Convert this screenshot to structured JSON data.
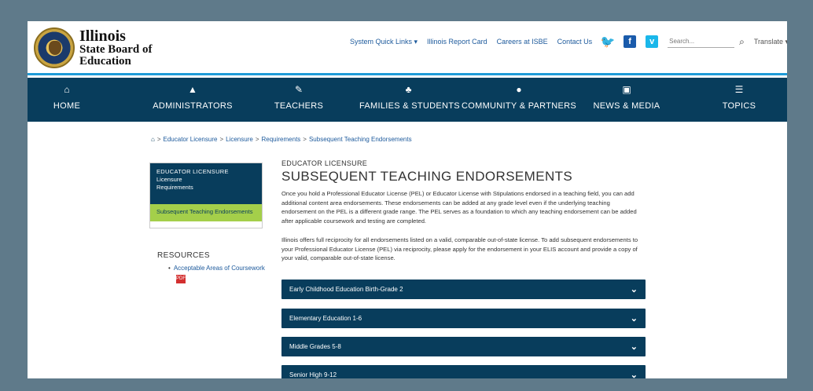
{
  "header": {
    "logo_line1": "Illinois",
    "logo_line2": "State Board of",
    "logo_line3": "Education",
    "utility_links": [
      "System Quick Links ▾",
      "Illinois Report Card",
      "Careers at ISBE",
      "Contact Us"
    ],
    "search_placeholder": "Search...",
    "language": "Translate ▾"
  },
  "nav": [
    {
      "label": "HOME",
      "icon": "home-icon",
      "glyph": "⌂"
    },
    {
      "label": "ADMINISTRATORS",
      "icon": "administrator-icon",
      "glyph": "▲"
    },
    {
      "label": "TEACHERS",
      "icon": "teacher-icon",
      "glyph": "✎"
    },
    {
      "label": "FAMILIES & STUDENTS",
      "icon": "family-icon",
      "glyph": "♣"
    },
    {
      "label": "COMMUNITY & PARTNERS",
      "icon": "community-icon",
      "glyph": "●"
    },
    {
      "label": "NEWS & MEDIA",
      "icon": "news-icon",
      "glyph": "▣"
    },
    {
      "label": "TOPICS",
      "icon": "topics-icon",
      "glyph": "☰"
    }
  ],
  "breadcrumb": [
    "Educator Licensure",
    "Licensure",
    "Requirements",
    "Subsequent Teaching Endorsements"
  ],
  "sidebar": {
    "heading": "EDUCATOR LICENSURE",
    "items": [
      "Licensure",
      "Requirements"
    ],
    "active": "Subsequent Teaching Endorsements"
  },
  "resources": {
    "title": "RESOURCES",
    "items": [
      "Acceptable Areas of Coursework"
    ]
  },
  "main": {
    "kicker": "EDUCATOR LICENSURE",
    "title": "SUBSEQUENT TEACHING ENDORSEMENTS",
    "paragraph1": "Once you hold a Professional Educator License (PEL) or Educator License with Stipulations endorsed in a teaching field, you can add additional content area endorsements. These endorsements can be added at any grade level even if the underlying teaching endorsement on the PEL is a different grade range. The PEL serves as a foundation to which any teaching endorsement can be added after applicable coursework and testing are completed.",
    "paragraph2": "Illinois offers full reciprocity for all endorsements listed on a valid, comparable out-of-state license. To add subsequent endorsements to your Professional Educator License (PEL) via reciprocity, please apply for the endorsement in your ELIS account and provide a copy of your valid, comparable out-of-state license.",
    "accordions": [
      "Early Childhood Education Birth-Grade 2",
      "Elementary Education 1-6",
      "Middle Grades 5-8",
      "Senior High 9-12"
    ]
  },
  "colors": {
    "navy": "#083d5c",
    "accent_blue": "#1f9bd7",
    "lime": "#a4cf4a",
    "backdrop": "#5f7a8a"
  }
}
